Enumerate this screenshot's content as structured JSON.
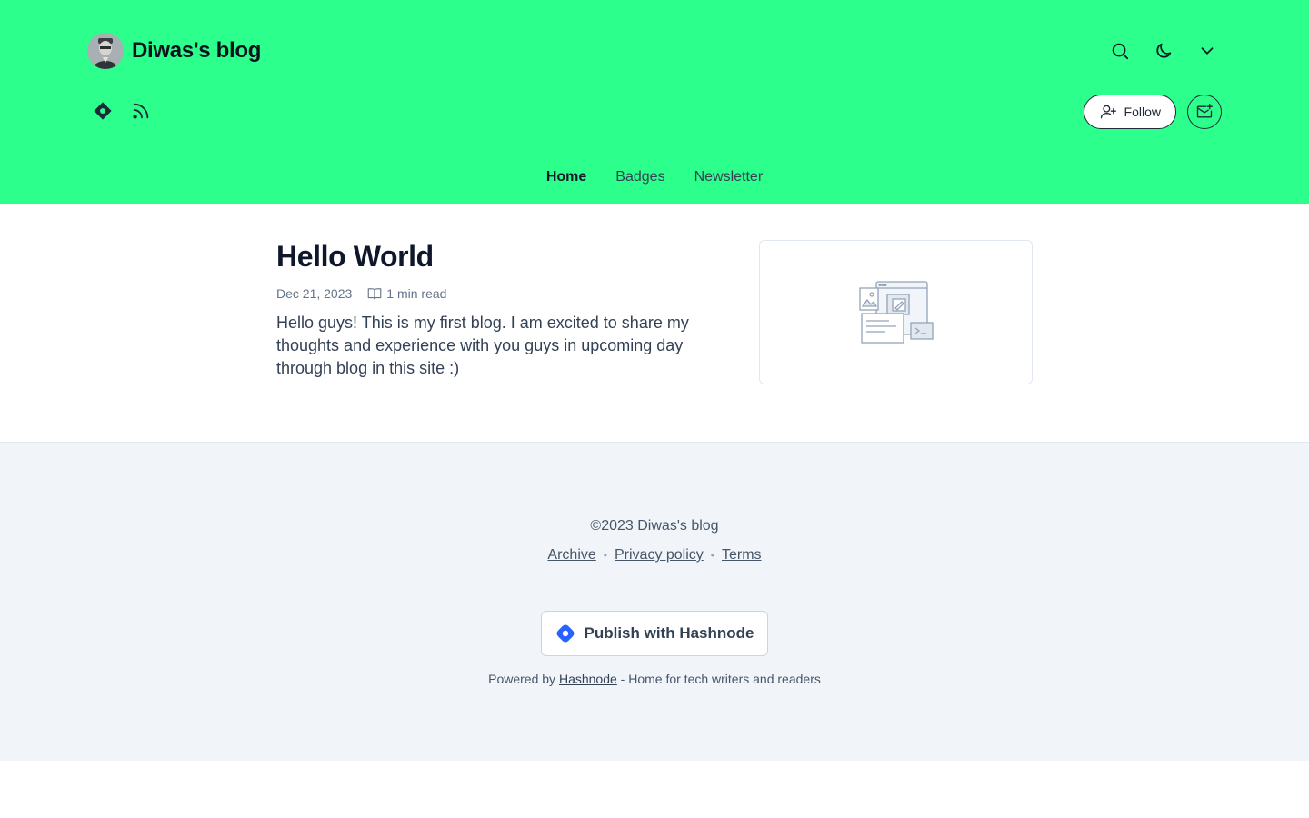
{
  "header": {
    "blog_title": "Diwas's blog",
    "follow_label": "Follow",
    "nav": [
      {
        "label": "Home",
        "active": true
      },
      {
        "label": "Badges",
        "active": false
      },
      {
        "label": "Newsletter",
        "active": false
      }
    ],
    "icons": {
      "search": "search-icon",
      "theme": "moon-icon",
      "menu": "chevron-down-icon",
      "hashnode": "hashnode-icon",
      "rss": "rss-icon",
      "follow": "user-plus-icon",
      "newsletter": "mail-plus-icon"
    },
    "bg_color": "#2cff8b"
  },
  "post": {
    "title": "Hello World",
    "date": "Dec 21, 2023",
    "read_time": "1 min read",
    "excerpt": "Hello guys! This is my first blog. I am excited to share my thoughts and experience with you guys in upcoming day through blog in this site :)"
  },
  "footer": {
    "copyright": "©2023 Diwas's blog",
    "links": [
      "Archive",
      "Privacy policy",
      "Terms"
    ],
    "publish_label": "Publish with Hashnode",
    "powered_prefix": "Powered by",
    "powered_link": "Hashnode",
    "powered_suffix": "- Home for tech writers and readers"
  }
}
